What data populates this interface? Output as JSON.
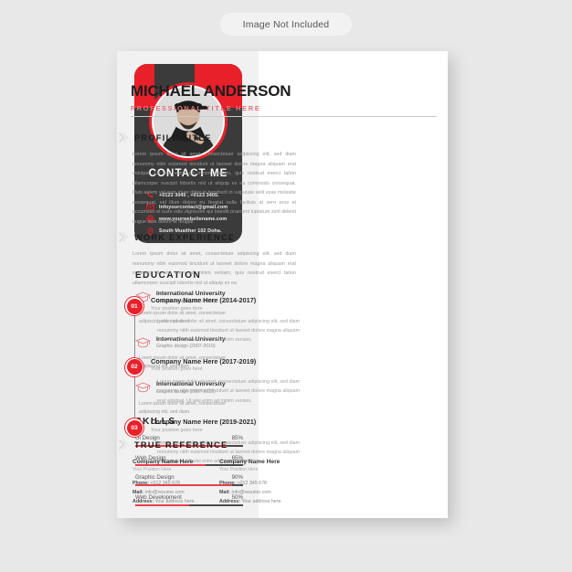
{
  "notice": {
    "label": "Image Not Included"
  },
  "theme": {
    "accent": "#e8202a",
    "accent_soft": "#e8404a",
    "dark": "#3b3b3b",
    "left_bg": "#f1f1f1",
    "page_bg": "#e8e8e8"
  },
  "header": {
    "name": "MICHAEL ANDERSON",
    "job_title": "PROFESSIONAL TITLE HERE"
  },
  "contact": {
    "title": "CONTACT ME",
    "items": [
      {
        "icon": "phone-icon",
        "text": "+0123 3045 , +0123 3405."
      },
      {
        "icon": "envelope-icon",
        "text": "Infoyourcontact@gmail.com"
      },
      {
        "icon": "globe-icon",
        "text": "www.yourwebsitename.com"
      },
      {
        "icon": "location-pin-icon",
        "text": "South Muaither 102 Doha."
      }
    ]
  },
  "education": {
    "title": "EDUCATION",
    "items": [
      {
        "icon": "graduation-cap-icon",
        "school": "International University",
        "degree": "Graphic design (2007-2010)",
        "desc": "Lorem ipsum dolor sit amet, consectetuer adipiscing elit, sed diam"
      },
      {
        "icon": "graduation-cap-icon",
        "school": "International University",
        "degree": "Graphic design (2007-2010)",
        "desc": "Lorem ipsum dolor sit amet, consectetuer adipiscing elit, sed diam"
      },
      {
        "icon": "graduation-cap-icon",
        "school": "International University",
        "degree": "Graphic design (2007-2010)",
        "desc": "Lorem ipsum dolor sit amet, consectetuer adipiscing elit, sed diam"
      }
    ]
  },
  "skills": {
    "title": "SKILLS",
    "items": [
      {
        "name": "Ui Design",
        "percent_label": "85%",
        "percent": 85
      },
      {
        "name": "Web Design",
        "percent_label": "65%",
        "percent": 65
      },
      {
        "name": "Graphic Design",
        "percent_label": "90%",
        "percent": 90
      },
      {
        "name": "Web Development",
        "percent_label": "50%",
        "percent": 50
      }
    ]
  },
  "profile": {
    "title": "PROFILE TITLE",
    "icon": "double-chevron-right-icon",
    "body": "Lorem ipsum dolor sit amet, consectetuer adipiscing elit, sed diam nonummy nibh euismod tincidunt ut laoreet dolore magna aliquam erat volutpat. Ut wisi enim ad minim veniam, quis nostrud exerci tation ullamcorper suscipit lobortis nisl ut aliquip ex ea commodo consequat. Duis autem vel eum iriure dolor in hendrerit in vulputate velit esse molestie consequat, vel illum dolore eu feugiat nulla facilisis at vero eros et accumsan et iusto odio dignissim qui blandit praesent luptatum zzril delenit augue duis dolore te feugait"
  },
  "work": {
    "title": "WORK EXPERIENCE",
    "icon": "double-chevron-right-icon",
    "body": "Lorem ipsum dolor sit amet, consectetuer adipiscing elit, sed diam nonummy nibh euismod tincidunt ut laoreet dolore magna aliquam erat volutpat. Ut wisi enim ad minim veniam, quis nostrud exerci tation ullamcorper suscipit lobortis nisl ut aliquip ex ea",
    "items": [
      {
        "number": "01",
        "company": "Company Name Here (2014-2017)",
        "position": "Your position goes here",
        "desc": "Lorem ipsum dolor sit amet, consectetuer adipiscing elit, sed diam nonummy nibh euismod tincidunt ut laoreet dolore magna aliquam erat volutpat. Ut wisi enim ad minim veniam,"
      },
      {
        "number": "02",
        "company": "Company Name Here (2017-2019)",
        "position": "Your position goes here",
        "desc": "Lorem ipsum dolor sit amet, consectetuer adipiscing elit, sed diam nonummy nibh euismod tincidunt ut laoreet dolore magna aliquam erat volutpat. Ut wisi enim ad minim veniam,"
      },
      {
        "number": "03",
        "company": "Company Name Here (2019-2021)",
        "position": "Your position goes here",
        "desc": "Lorem ipsum dolor sit amet, consectetuer adipiscing elit, sed diam nonummy nibh euismod tincidunt ut laoreet dolore magna aliquam erat volutpat. Ut wisi enim ad minim veniam,"
      }
    ]
  },
  "reference": {
    "title": "TRUE REFERENCE",
    "icon": "double-chevron-right-icon",
    "items": [
      {
        "company": "Company Name Here",
        "position": "Your Position Here",
        "phone_label": "Phone:",
        "phone": " +012 345 678",
        "mail_label": "Mail:",
        "mail": " info@resume.com",
        "address_label": "Address:",
        "address": " Your address here."
      },
      {
        "company": "Company Name Here",
        "position": "Your Position Here",
        "phone_label": "Phone:",
        "phone": " +012 345 678",
        "mail_label": "Mail:",
        "mail": " info@resume.com",
        "address_label": "Address:",
        "address": " Your address here."
      }
    ]
  }
}
